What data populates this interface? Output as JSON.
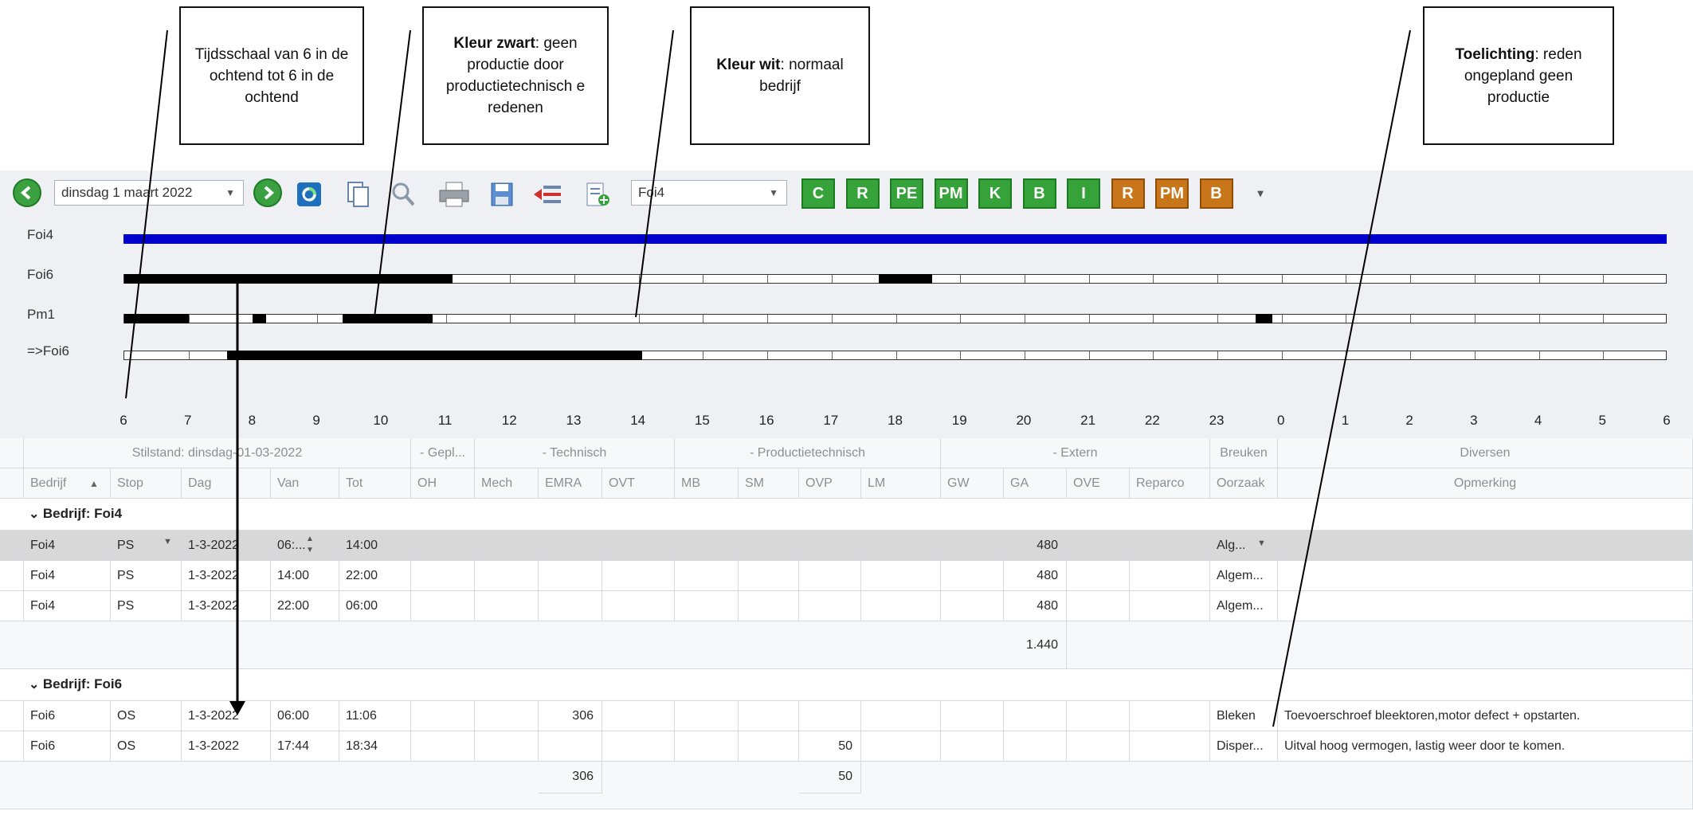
{
  "callouts": {
    "c1": {
      "text": "Tijdsschaal van 6 in de ochtend tot 6 in de ochtend"
    },
    "c2": {
      "bold": "Kleur zwart",
      "text": ": geen productie door productietechnisch e redenen"
    },
    "c3": {
      "bold": "Kleur wit",
      "text": ": normaal bedrijf"
    },
    "c4": {
      "bold": "Toelichting",
      "text": ": reden ongepland geen productie"
    }
  },
  "toolbar": {
    "date_value": "dinsdag 1 maart 2022",
    "plant_value": "Foi4",
    "icons": [
      "back-arrow-icon",
      "forward-arrow-icon",
      "refresh-icon",
      "copy-icon",
      "search-icon",
      "print-icon",
      "save-icon",
      "remove-row-icon",
      "add-row-icon"
    ],
    "buttons": [
      {
        "label": "C",
        "color": "green"
      },
      {
        "label": "R",
        "color": "green"
      },
      {
        "label": "PE",
        "color": "green"
      },
      {
        "label": "PM",
        "color": "green"
      },
      {
        "label": "K",
        "color": "green"
      },
      {
        "label": "B",
        "color": "green"
      },
      {
        "label": "I",
        "color": "green"
      },
      {
        "label": "R",
        "color": "orange"
      },
      {
        "label": "PM",
        "color": "orange"
      },
      {
        "label": "B",
        "color": "orange"
      }
    ],
    "more": "▾"
  },
  "timeline": {
    "rows": [
      {
        "label": "Foi4",
        "full_blue": true,
        "black": []
      },
      {
        "label": "Foi6",
        "full_blue": false,
        "black": [
          [
            6.0,
            11.1
          ],
          [
            17.73,
            18.57
          ]
        ]
      },
      {
        "label": "Pm1",
        "full_blue": false,
        "black": [
          [
            6.0,
            7.0
          ],
          [
            8.0,
            8.2
          ],
          [
            9.4,
            10.8
          ],
          [
            23.6,
            23.85
          ]
        ]
      },
      {
        "label": "=>Foi6",
        "full_blue": false,
        "black": [
          [
            7.6,
            14.05
          ]
        ]
      }
    ],
    "hours": [
      "6",
      "7",
      "8",
      "9",
      "10",
      "11",
      "12",
      "13",
      "14",
      "15",
      "16",
      "17",
      "18",
      "19",
      "20",
      "21",
      "22",
      "23",
      "0",
      "1",
      "2",
      "3",
      "4",
      "5",
      "6"
    ]
  },
  "grid": {
    "group_headers": {
      "stilstand": "Stilstand: dinsdag-01-03-2022",
      "gepl": "- Gepl...",
      "technisch": "- Technisch",
      "productietechnisch": "- Productietechnisch",
      "extern": "- Extern",
      "breuken": "Breuken",
      "diversen": "Diversen"
    },
    "columns": {
      "bedrijf": "Bedrijf",
      "stop": "Stop",
      "dag": "Dag",
      "van": "Van",
      "tot": "Tot",
      "oh": "OH",
      "mech": "Mech",
      "emra": "EMRA",
      "ovt": "OVT",
      "mb": "MB",
      "sm": "SM",
      "ovp": "OVP",
      "lm": "LM",
      "gw": "GW",
      "ga": "GA",
      "ove": "OVE",
      "reparco": "Reparco",
      "oorzaak": "Oorzaak",
      "opmerking": "Opmerking"
    },
    "group1": {
      "title": "Bedrijf: Foi4",
      "rows": [
        {
          "bedrijf": "Foi4",
          "stop": "PS",
          "dag": "1-3-2022",
          "van": "06:...",
          "tot": "14:00",
          "ga": "480",
          "oorzaak": "Alg...",
          "opmerking": ""
        },
        {
          "bedrijf": "Foi4",
          "stop": "PS",
          "dag": "1-3-2022",
          "van": "14:00",
          "tot": "22:00",
          "ga": "480",
          "oorzaak": "Algem...",
          "opmerking": ""
        },
        {
          "bedrijf": "Foi4",
          "stop": "PS",
          "dag": "1-3-2022",
          "van": "22:00",
          "tot": "06:00",
          "ga": "480",
          "oorzaak": "Algem...",
          "opmerking": ""
        }
      ],
      "total_ga": "1.440"
    },
    "group2": {
      "title": "Bedrijf: Foi6",
      "rows": [
        {
          "bedrijf": "Foi6",
          "stop": "OS",
          "dag": "1-3-2022",
          "van": "06:00",
          "tot": "11:06",
          "emra": "306",
          "ovp": "",
          "oorzaak": "Bleken",
          "opmerking": "Toevoerschroef bleektoren,motor defect + opstarten."
        },
        {
          "bedrijf": "Foi6",
          "stop": "OS",
          "dag": "1-3-2022",
          "van": "17:44",
          "tot": "18:34",
          "emra": "",
          "ovp": "50",
          "oorzaak": "Disper...",
          "opmerking": "Uitval hoog vermogen, lastig weer door te komen."
        }
      ],
      "total_emra": "306",
      "total_ovp": "50"
    }
  },
  "colors": {
    "bar_blue": "#0000cc",
    "green_button": "#36a33a",
    "orange_button": "#c9761b",
    "panel_bg": "#eef0f3"
  }
}
